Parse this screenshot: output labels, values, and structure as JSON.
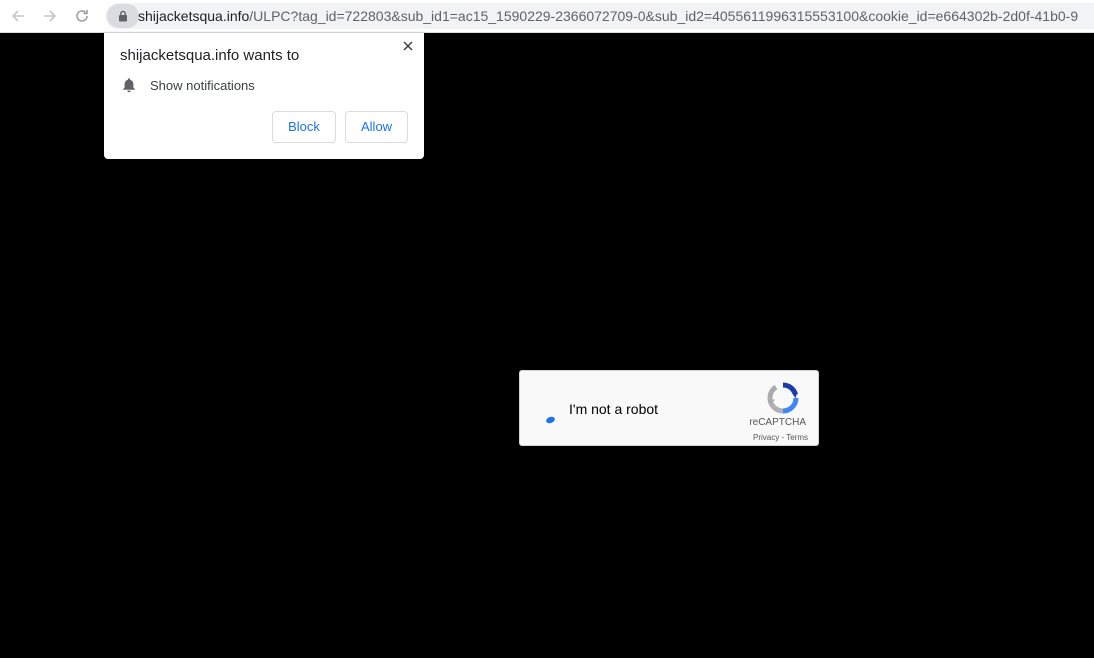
{
  "browser": {
    "url_domain": "shijacketsqua.info",
    "url_path": "/ULPC?tag_id=722803&sub_id1=ac15_1590229-2366072709-0&sub_id2=4055611996315553100&cookie_id=e664302b-2d0f-41b0-9",
    "icons": {
      "back": "arrow-left-icon",
      "forward": "arrow-right-icon",
      "reload": "reload-icon",
      "lock": "lock-icon"
    }
  },
  "permission_prompt": {
    "title": "shijacketsqua.info wants to",
    "permission_label": "Show notifications",
    "block_label": "Block",
    "allow_label": "Allow",
    "accent_color": "#1a73e8"
  },
  "captcha": {
    "label": "I'm not a robot",
    "brand": "reCAPTCHA",
    "privacy_label": "Privacy",
    "separator": " - ",
    "terms_label": "Terms"
  }
}
